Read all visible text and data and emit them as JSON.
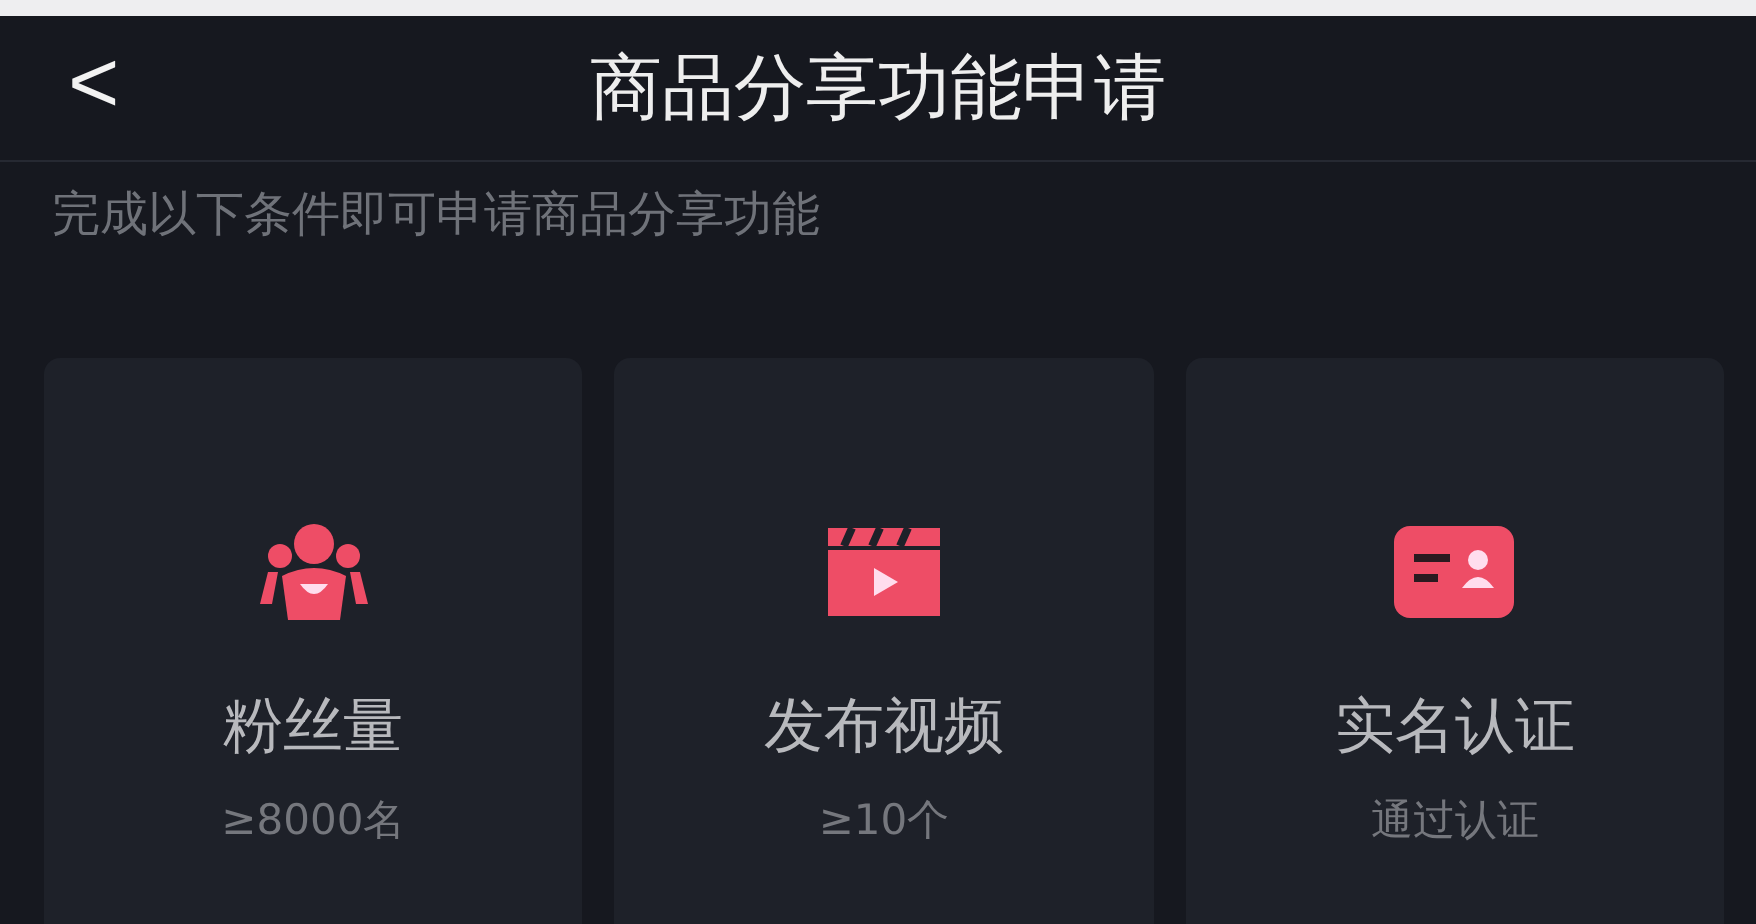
{
  "header": {
    "back": "<",
    "title": "商品分享功能申请"
  },
  "subtitle": "完成以下条件即可申请商品分享功能",
  "cards": [
    {
      "kind": "fans",
      "title": "粉丝量",
      "requirement": "≥8000名"
    },
    {
      "kind": "video",
      "title": "发布视频",
      "requirement": "≥10个"
    },
    {
      "kind": "id",
      "title": "实名认证",
      "requirement": "通过认证"
    }
  ]
}
